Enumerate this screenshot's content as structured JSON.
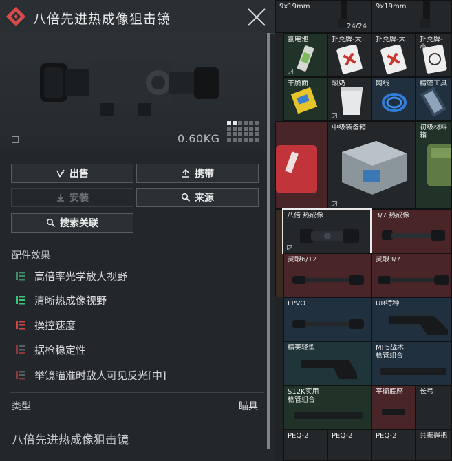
{
  "panel": {
    "title": "八倍先进热成像狙击镜",
    "weight": "0.60KG",
    "buttons": {
      "sell": "出售",
      "carry": "携带",
      "install": "安装",
      "source": "来源",
      "search_related": "搜索关联"
    },
    "section_title": "配件效果",
    "effects": [
      {
        "text": "高倍率光学放大视野",
        "kind": "neutral-positive",
        "color": "#3e8c68"
      },
      {
        "text": "清晰热成像视野",
        "kind": "positive",
        "color": "#39c47d"
      },
      {
        "text": "操控速度",
        "kind": "negative",
        "color": "#d24444"
      },
      {
        "text": "据枪稳定性",
        "kind": "slight-negative",
        "color": "#8d3a3a"
      },
      {
        "text": "举镜瞄准时敌人可见反光[中]",
        "kind": "slight-negative",
        "color": "#8d3a3a"
      }
    ],
    "type_label": "类型",
    "type_value": "瞄具",
    "item_name": "八倍先进热成像狙击镜"
  },
  "grid": {
    "row0": [
      {
        "label": "9x19mm",
        "count": "24/24"
      },
      {
        "label": "9x19mm",
        "count": ""
      }
    ],
    "row0_partial": "5",
    "row1": [
      {
        "label": "氢电池"
      },
      {
        "label": "扑克牌-大..."
      },
      {
        "label": "扑克牌-大..."
      },
      {
        "label": "扑克牌-小..."
      }
    ],
    "row2": [
      {
        "label": "干脆面"
      },
      {
        "label": "酸奶"
      },
      {
        "label": "网线"
      },
      {
        "label": "精密工具"
      }
    ],
    "row3": [
      {
        "label": "中级装备箱"
      },
      {
        "label": "初级材料箱"
      }
    ],
    "scopes": [
      {
        "label": "八倍 热成像"
      },
      {
        "label": "3/7 热成像"
      },
      {
        "label": "灵眼6/12"
      },
      {
        "label": "灵眼3/7"
      },
      {
        "label": "LPVO"
      },
      {
        "label": "UR特种"
      },
      {
        "label": "精英轻型"
      },
      {
        "label": "MP5战术\n枪管组合"
      },
      {
        "label": "S12K实用\n枪管组合"
      },
      {
        "label": "平衡底座"
      },
      {
        "label": "长弓"
      },
      {
        "label": "PEQ-2"
      },
      {
        "label": "PEQ-2"
      },
      {
        "label": "PEQ-2"
      },
      {
        "label": "共振握把"
      }
    ]
  }
}
